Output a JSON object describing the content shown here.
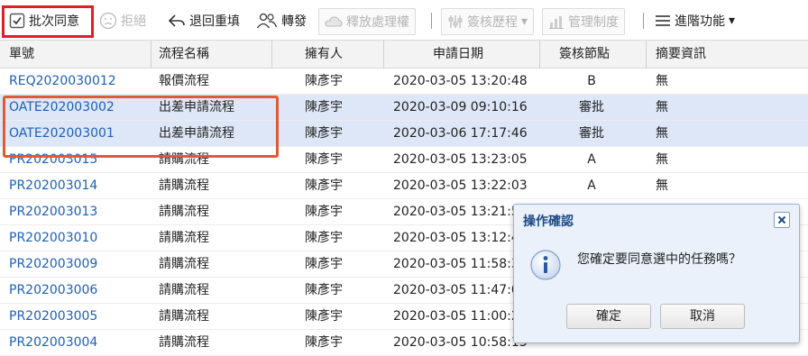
{
  "toolbar": {
    "batch_approve": "批次同意",
    "reject": "拒絕",
    "return_redo": "退回重填",
    "forward": "轉發",
    "release_handling": "釋放處理權",
    "approval_history": "簽核歷程",
    "management_system": "管理制度",
    "advanced": "進階功能"
  },
  "columns": [
    "單號",
    "流程名稱",
    "擁有人",
    "申請日期",
    "簽核節點",
    "摘要資訊"
  ],
  "rows": [
    {
      "id": "REQ2020030012",
      "flow": "報價流程",
      "owner": "陳彥宇",
      "date": "2020-03-05 13:20:48",
      "node": "B",
      "summary": "無"
    },
    {
      "id": "OATE202003002",
      "flow": "出差申請流程",
      "owner": "陳彥宇",
      "date": "2020-03-09 09:10:16",
      "node": "審批",
      "summary": "無"
    },
    {
      "id": "OATE202003001",
      "flow": "出差申請流程",
      "owner": "陳彥宇",
      "date": "2020-03-06 17:17:46",
      "node": "審批",
      "summary": "無"
    },
    {
      "id": "PR202003015",
      "flow": "請購流程",
      "owner": "陳彥宇",
      "date": "2020-03-05 13:23:05",
      "node": "A",
      "summary": "無"
    },
    {
      "id": "PR202003014",
      "flow": "請購流程",
      "owner": "陳彥宇",
      "date": "2020-03-05 13:22:03",
      "node": "A",
      "summary": "無"
    },
    {
      "id": "PR202003013",
      "flow": "請購流程",
      "owner": "陳彥宇",
      "date": "2020-03-05 13:21:5",
      "node": "",
      "summary": ""
    },
    {
      "id": "PR202003010",
      "flow": "請購流程",
      "owner": "陳彥宇",
      "date": "2020-03-05 13:12:4",
      "node": "",
      "summary": ""
    },
    {
      "id": "PR202003009",
      "flow": "請購流程",
      "owner": "陳彥宇",
      "date": "2020-03-05 11:58:3",
      "node": "",
      "summary": ""
    },
    {
      "id": "PR202003006",
      "flow": "請購流程",
      "owner": "陳彥宇",
      "date": "2020-03-05 11:47:0",
      "node": "",
      "summary": ""
    },
    {
      "id": "PR202003005",
      "flow": "請購流程",
      "owner": "陳彥宇",
      "date": "2020-03-05 11:00:2",
      "node": "",
      "summary": ""
    },
    {
      "id": "PR202003004",
      "flow": "請購流程",
      "owner": "陳彥宇",
      "date": "2020-03-05 10:58:13",
      "node": "",
      "summary": ""
    }
  ],
  "dialog": {
    "title": "操作確認",
    "message": "您確定要同意選中的任務嗎？",
    "ok": "確定",
    "cancel": "取消"
  }
}
